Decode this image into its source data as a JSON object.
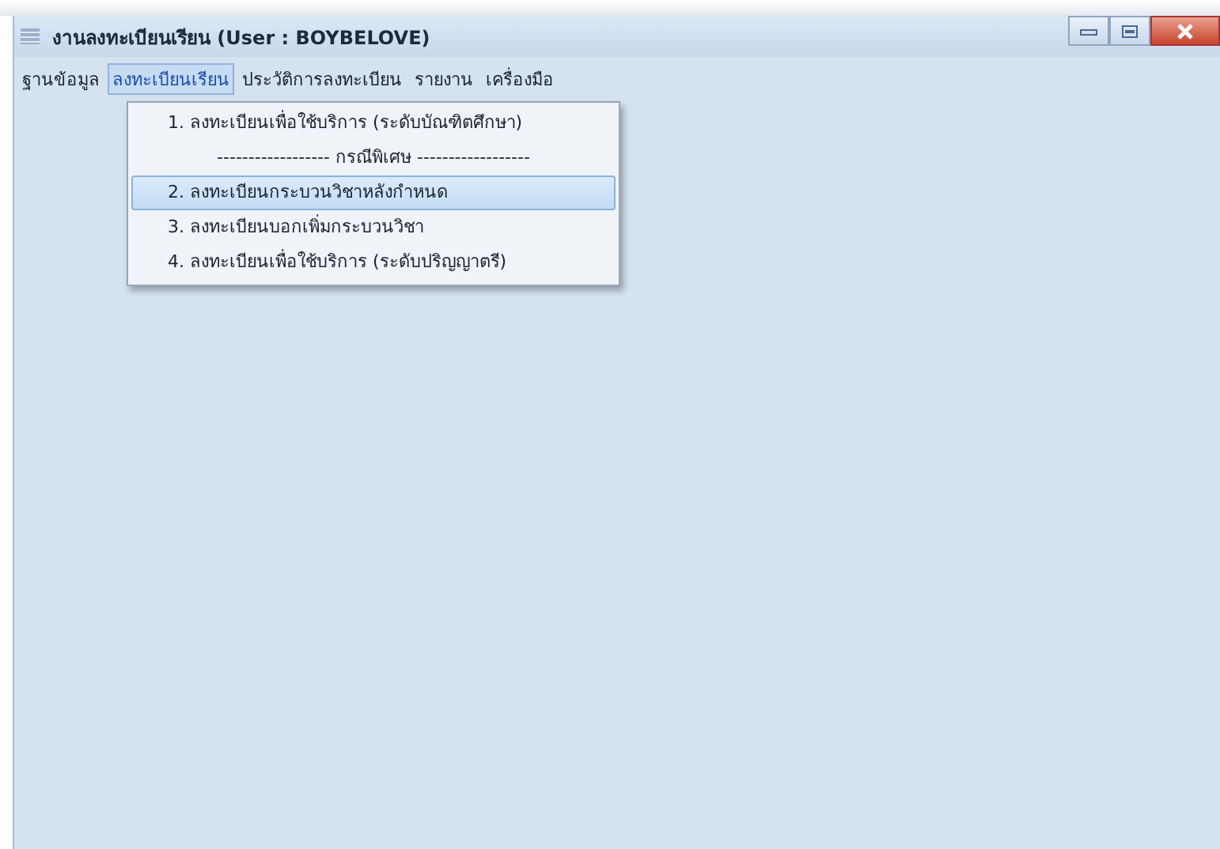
{
  "window": {
    "title": "งานลงทะเบียนเรียน  (User : BOYBELOVE)"
  },
  "menu_bar": [
    {
      "label": "ฐานข้อมูล",
      "selected": false
    },
    {
      "label": "ลงทะเบียนเรียน",
      "selected": true
    },
    {
      "label": "ประวัติการลงทะเบียน",
      "selected": false
    },
    {
      "label": "รายงาน",
      "selected": false
    },
    {
      "label": "เครื่องมือ",
      "selected": false
    }
  ],
  "dropdown": [
    {
      "kind": "item",
      "label": "1. ลงทะเบียนเพื่อใช้บริการ (ระดับบัณฑิตศึกษา)",
      "selected": false
    },
    {
      "kind": "separator",
      "label": "------------------ กรณีพิเศษ ------------------",
      "selected": false
    },
    {
      "kind": "item",
      "label": "2. ลงทะเบียนกระบวนวิชาหลังกำหนด",
      "selected": true
    },
    {
      "kind": "item",
      "label": "3. ลงทะเบียนบอกเพิ่มกระบวนวิชา",
      "selected": false
    },
    {
      "kind": "item",
      "label": "4. ลงทะเบียนเพื่อใช้บริการ (ระดับปริญญาตรี)",
      "selected": false
    }
  ]
}
